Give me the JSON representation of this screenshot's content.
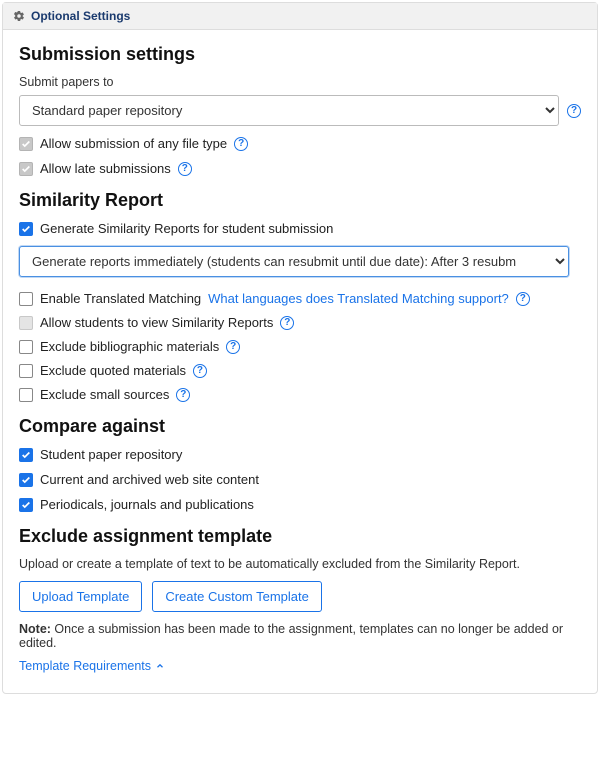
{
  "header": {
    "title": "Optional Settings"
  },
  "submission": {
    "heading": "Submission settings",
    "submit_to_label": "Submit papers to",
    "submit_to_value": "Standard paper repository",
    "allow_any_file_label": "Allow submission of any file type",
    "allow_any_file_checked": true,
    "allow_late_label": "Allow late submissions",
    "allow_late_checked": true
  },
  "similarity": {
    "heading": "Similarity Report",
    "generate_label": "Generate Similarity Reports for student submission",
    "generate_checked": true,
    "report_timing_value": "Generate reports immediately (students can resubmit until due date): After 3 resubm",
    "translated_label": "Enable Translated Matching",
    "translated_checked": false,
    "translated_link": "What languages does Translated Matching support?",
    "allow_view_label": "Allow students to view Similarity Reports",
    "allow_view_checked": false,
    "exclude_bib_label": "Exclude bibliographic materials",
    "exclude_bib_checked": false,
    "exclude_quoted_label": "Exclude quoted materials",
    "exclude_quoted_checked": false,
    "exclude_small_label": "Exclude small sources",
    "exclude_small_checked": false
  },
  "compare": {
    "heading": "Compare against",
    "student_repo_label": "Student paper repository",
    "student_repo_checked": true,
    "web_label": "Current and archived web site content",
    "web_checked": true,
    "periodicals_label": "Periodicals, journals and publications",
    "periodicals_checked": true
  },
  "exclude_template": {
    "heading": "Exclude assignment template",
    "desc": "Upload or create a template of text to be automatically excluded from the Similarity Report.",
    "upload_btn": "Upload Template",
    "create_btn": "Create Custom Template",
    "note_label": "Note:",
    "note_text": " Once a submission has been made to the assignment, templates can no longer be added or edited.",
    "requirements_link": "Template Requirements"
  }
}
